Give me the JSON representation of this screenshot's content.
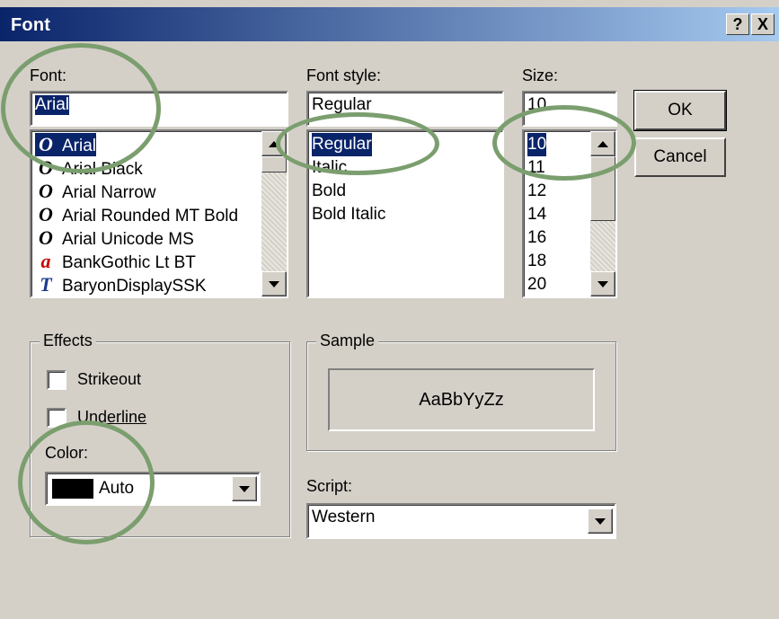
{
  "window": {
    "title": "Font",
    "help_label": "?",
    "close_label": "X"
  },
  "font": {
    "label": "Font:",
    "value": "Arial",
    "items": [
      {
        "name": "Arial",
        "icon": "opentype-icon",
        "glyph": "O",
        "color": "#8b1a6b",
        "selected": true
      },
      {
        "name": "Arial Black",
        "icon": "opentype-icon",
        "glyph": "O",
        "color": "#000000",
        "selected": false
      },
      {
        "name": "Arial Narrow",
        "icon": "opentype-icon",
        "glyph": "O",
        "color": "#000000",
        "selected": false
      },
      {
        "name": "Arial Rounded MT Bold",
        "icon": "opentype-icon",
        "glyph": "O",
        "color": "#000000",
        "selected": false
      },
      {
        "name": "Arial Unicode MS",
        "icon": "opentype-icon",
        "glyph": "O",
        "color": "#000000",
        "selected": false
      },
      {
        "name": "BankGothic Lt BT",
        "icon": "type1-icon",
        "glyph": "a",
        "color": "#cc0000",
        "selected": false
      },
      {
        "name": "BaryonDisplaySSK",
        "icon": "truetype-icon",
        "glyph": "T",
        "color": "#1a3a8b",
        "selected": false
      }
    ]
  },
  "style": {
    "label": "Font style:",
    "value": "Regular",
    "items": [
      {
        "name": "Regular",
        "selected": true
      },
      {
        "name": "Italic",
        "selected": false
      },
      {
        "name": "Bold",
        "selected": false
      },
      {
        "name": "Bold Italic",
        "selected": false
      }
    ]
  },
  "size": {
    "label": "Size:",
    "value": "10",
    "items": [
      {
        "name": "10",
        "selected": true
      },
      {
        "name": "11",
        "selected": false
      },
      {
        "name": "12",
        "selected": false
      },
      {
        "name": "14",
        "selected": false
      },
      {
        "name": "16",
        "selected": false
      },
      {
        "name": "18",
        "selected": false
      },
      {
        "name": "20",
        "selected": false
      }
    ]
  },
  "buttons": {
    "ok": "OK",
    "cancel": "Cancel"
  },
  "effects": {
    "label": "Effects",
    "strikeout": "Strikeout",
    "underline": "Underline",
    "color_label": "Color:",
    "color_value": "Auto",
    "color_swatch": "#000000"
  },
  "sample": {
    "label": "Sample",
    "text": "AaBbYyZz"
  },
  "script": {
    "label": "Script:",
    "value": "Western"
  }
}
